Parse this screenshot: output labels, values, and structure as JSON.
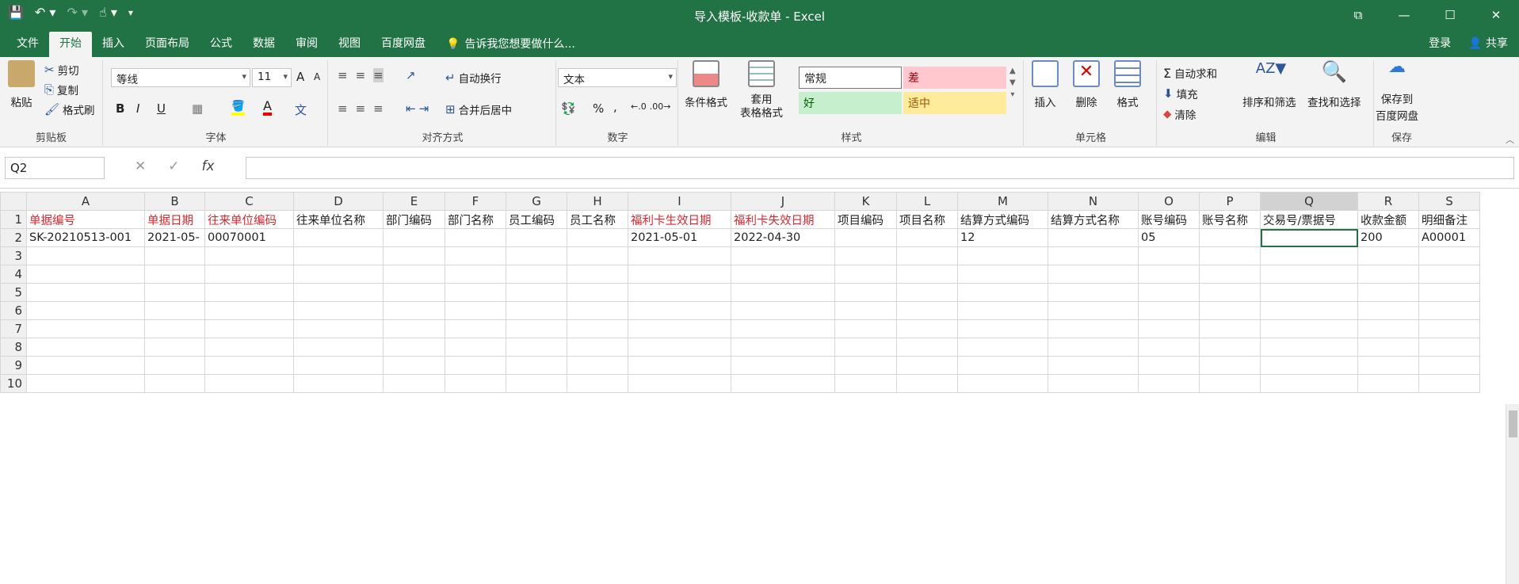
{
  "window": {
    "title": "导入模板-收款单 - Excel",
    "controls": [
      "⧉",
      "—",
      "☐",
      "✕"
    ]
  },
  "tabs": [
    "文件",
    "开始",
    "插入",
    "页面布局",
    "公式",
    "数据",
    "审阅",
    "视图",
    "百度网盘"
  ],
  "active_tab": "开始",
  "tellme": "告诉我您想要做什么...",
  "account": {
    "login": "登录",
    "share": "共享"
  },
  "ribbon": {
    "clipboard": {
      "label": "剪贴板",
      "paste": "粘贴",
      "cut": "剪切",
      "copy": "复制",
      "format_painter": "格式刷"
    },
    "font": {
      "label": "字体",
      "name": "等线",
      "size": "11",
      "bold": "B",
      "italic": "I",
      "underline": "U",
      "grow": "A",
      "shrink": "A"
    },
    "alignment": {
      "label": "对齐方式",
      "wrap": "自动换行",
      "merge": "合并后居中"
    },
    "number": {
      "label": "数字",
      "format": "文本",
      "percent": "%",
      "comma": ","
    },
    "styles": {
      "label": "样式",
      "conditional": "条件格式",
      "table_format": "套用\n表格格式",
      "normal": "常规",
      "bad": "差",
      "good": "好",
      "neutral": "适中"
    },
    "cells": {
      "label": "单元格",
      "insert": "插入",
      "delete": "删除",
      "format": "格式"
    },
    "editing": {
      "label": "编辑",
      "autosum": "自动求和",
      "fill": "填充",
      "clear": "清除",
      "sort": "排序和筛选",
      "find": "查找和选择"
    },
    "save": {
      "label": "保存",
      "btn1": "保存到",
      "btn2": "百度网盘"
    }
  },
  "formula_bar": {
    "name_box": "Q2",
    "cancel": "✕",
    "enter": "✓",
    "fx": "fx",
    "value": ""
  },
  "sheet": {
    "columns": [
      "A",
      "B",
      "C",
      "D",
      "E",
      "F",
      "G",
      "H",
      "I",
      "J",
      "K",
      "L",
      "M",
      "N",
      "O",
      "P",
      "Q",
      "R",
      "S"
    ],
    "header_row": [
      "单据编号",
      "单据日期",
      "往来单位编码",
      "往来单位名称",
      "部门编码",
      "部门名称",
      "员工编码",
      "员工名称",
      "福利卡生效日期",
      "福利卡失效日期",
      "项目编码",
      "项目名称",
      "结算方式编码",
      "结算方式名称",
      "账号编码",
      "账号名称",
      "交易号/票据号",
      "收款金额",
      "明细备注"
    ],
    "row2": [
      "SK-20210513-001",
      "2021-05-",
      "00070001",
      "",
      "",
      "",
      "",
      "",
      "2021-05-01",
      "2022-04-30",
      "",
      "",
      "12",
      "",
      "05",
      "",
      "",
      "200",
      "A00001"
    ],
    "row_numbers": [
      "1",
      "2",
      "3",
      "4",
      "5",
      "6",
      "7",
      "8",
      "9",
      "10"
    ],
    "active_cell": "Q2"
  },
  "colors": {
    "excel_green": "#217346",
    "required_red": "#e0262d"
  }
}
